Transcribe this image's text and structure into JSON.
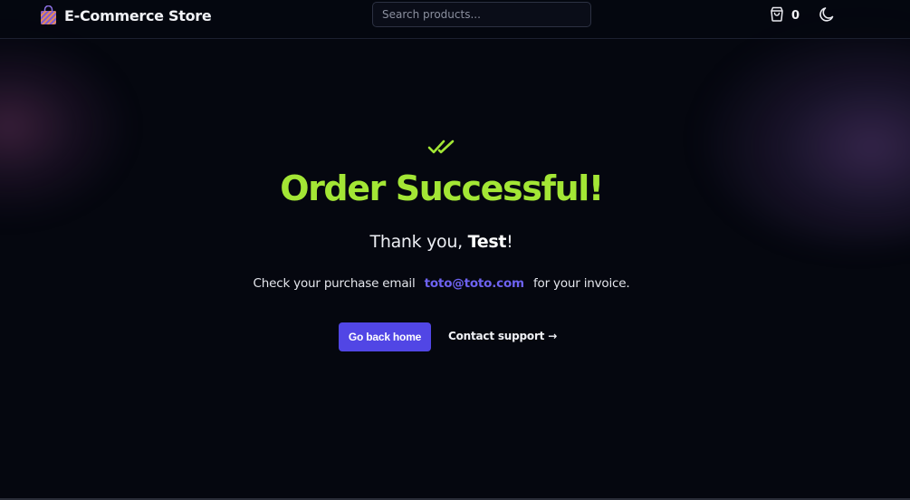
{
  "header": {
    "brand_name": "E-Commerce Store",
    "brand_icon": "shopping-bag-icon",
    "search": {
      "placeholder": "Search products...",
      "value": ""
    },
    "cart": {
      "icon": "cart-icon",
      "count": "0"
    },
    "theme_toggle_icon": "moon-icon"
  },
  "main": {
    "status_icon": "double-check-icon",
    "title": "Order Successful!",
    "thanks_prefix": "Thank you, ",
    "customer_name": "Test",
    "thanks_suffix": "!",
    "email_prefix": "Check your purchase email",
    "email": "toto@toto.com",
    "email_suffix": "for your invoice.",
    "primary_button": "Go back home",
    "secondary_link": "Contact support",
    "secondary_link_arrow": "→"
  },
  "colors": {
    "background": "#05070f",
    "success": "#a3e635",
    "accent": "#5146e5",
    "email_link": "#6d62f0"
  }
}
